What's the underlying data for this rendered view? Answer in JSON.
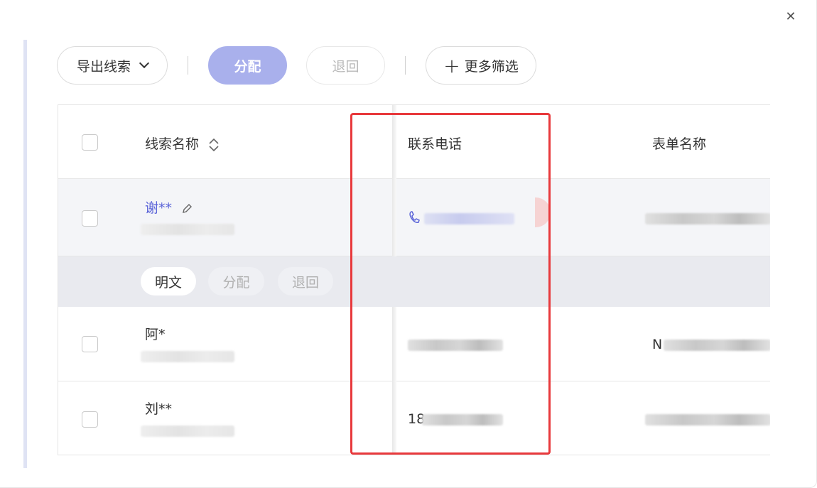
{
  "dialog": {
    "close_icon": "close-icon"
  },
  "toolbar": {
    "export_label": "导出线索",
    "assign_label": "分配",
    "return_label": "退回",
    "more_filters_label": "更多筛选"
  },
  "table": {
    "columns": [
      "线索名称",
      "联系电话",
      "表单名称"
    ],
    "rows": [
      {
        "name": "谢**",
        "phone_prefix": "",
        "form_prefix": ""
      },
      {
        "name": "阿*",
        "phone_prefix": "",
        "form_prefix": "N"
      },
      {
        "name": "刘**",
        "phone_prefix": "18",
        "form_prefix": ""
      }
    ],
    "row_actions": [
      "明文",
      "分配",
      "退回"
    ]
  },
  "colors": {
    "accent": "#5b64d8",
    "assign_button": "#a9b0ec",
    "highlight": "#e8393c"
  }
}
